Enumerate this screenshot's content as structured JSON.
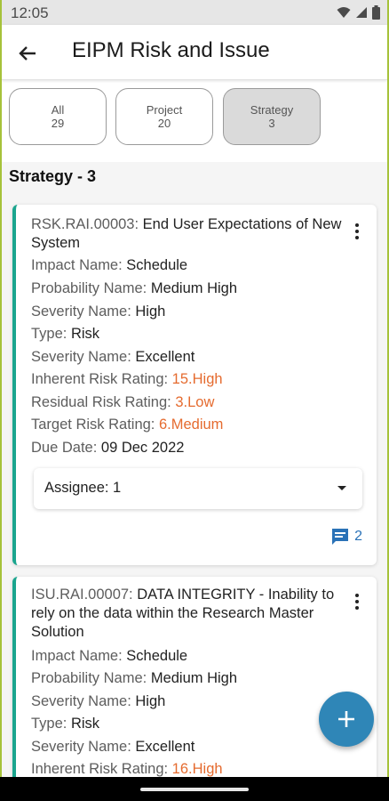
{
  "status_bar": {
    "time": "12:05"
  },
  "app_bar": {
    "title": "EIPM Risk and Issue"
  },
  "filters": [
    {
      "label": "All",
      "count": "29"
    },
    {
      "label": "Project",
      "count": "20"
    },
    {
      "label": "Strategy",
      "count": "3"
    }
  ],
  "section_title": "Strategy - 3",
  "cards": [
    {
      "code": "RSK.RAI.00003:",
      "title": "End User Expectations of New System",
      "fields": [
        {
          "label": " Impact Name:",
          "value": "Schedule"
        },
        {
          "label": "Probability Name:",
          "value": "Medium High"
        },
        {
          "label": "Severity Name:",
          "value": "High"
        },
        {
          "label": "Type:",
          "value": "Risk"
        },
        {
          "label": "Severity Name:",
          "value": "Excellent"
        },
        {
          "label": "Inherent Risk Rating:",
          "value": "15.High"
        },
        {
          "label": "Residual Risk Rating:",
          "value": "3.Low"
        },
        {
          "label": "Target Risk Rating:",
          "value": "6.Medium"
        },
        {
          "label": "Due Date:",
          "value": "09 Dec 2022"
        }
      ],
      "assignee": "Assignee: 1",
      "comment_count": "2"
    },
    {
      "code": "ISU.RAI.00007:",
      "title": "DATA INTEGRITY - Inability to rely on the data within the Research Master Solution",
      "fields": [
        {
          "label": " Impact Name:",
          "value": "Schedule"
        },
        {
          "label": "Probability Name:",
          "value": "Medium High"
        },
        {
          "label": "Severity Name:",
          "value": "High"
        },
        {
          "label": "Type:",
          "value": "Risk"
        },
        {
          "label": "Severity Name:",
          "value": "Excellent"
        },
        {
          "label": "Inherent Risk Rating:",
          "value": "16.High"
        }
      ]
    }
  ],
  "colors": {
    "accent": "#1aa58e",
    "rating": "#e56b2f",
    "fab": "#2f86b7",
    "link": "#2a72b7"
  }
}
